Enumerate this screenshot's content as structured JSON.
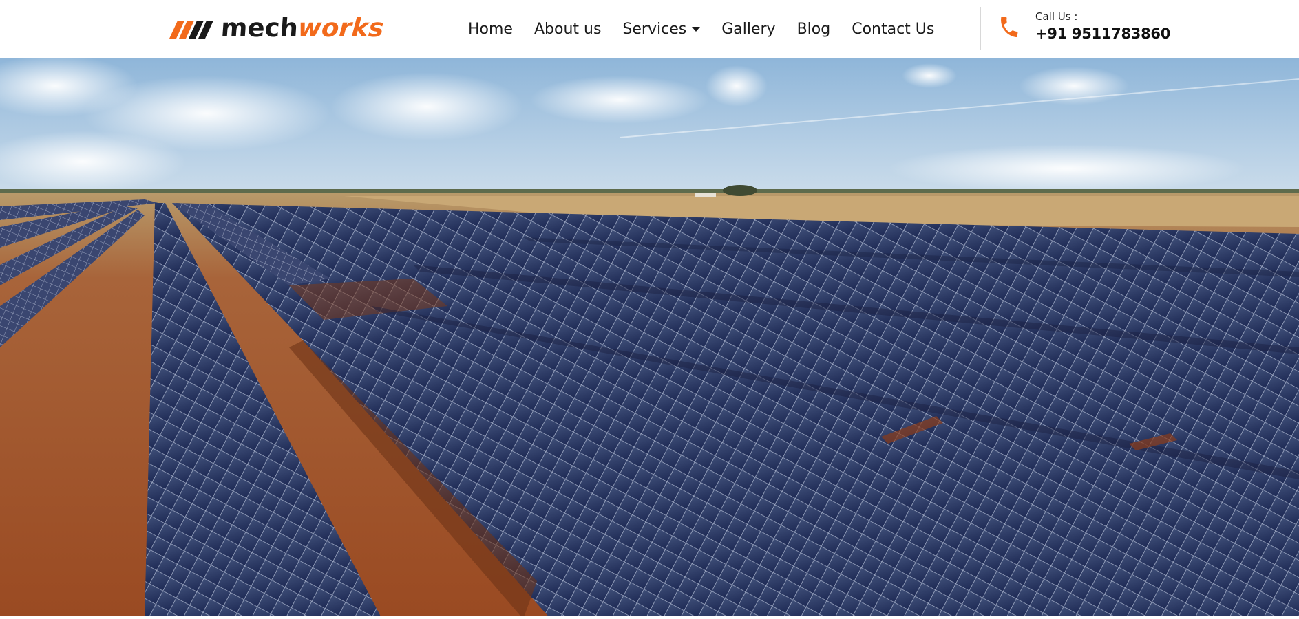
{
  "brand": {
    "name_part1": "mech",
    "name_part2": "works",
    "accent_color": "#f26a1b",
    "dark_color": "#1a1a1a"
  },
  "nav": {
    "items": [
      {
        "label": "Home"
      },
      {
        "label": "About us"
      },
      {
        "label": "Services",
        "has_dropdown": true
      },
      {
        "label": "Gallery"
      },
      {
        "label": "Blog"
      },
      {
        "label": "Contact Us"
      }
    ]
  },
  "call": {
    "label": "Call Us :",
    "number": "+91 9511783860",
    "icon": "phone-icon"
  },
  "hero": {
    "image": "solar-farm-aerial-photo"
  }
}
